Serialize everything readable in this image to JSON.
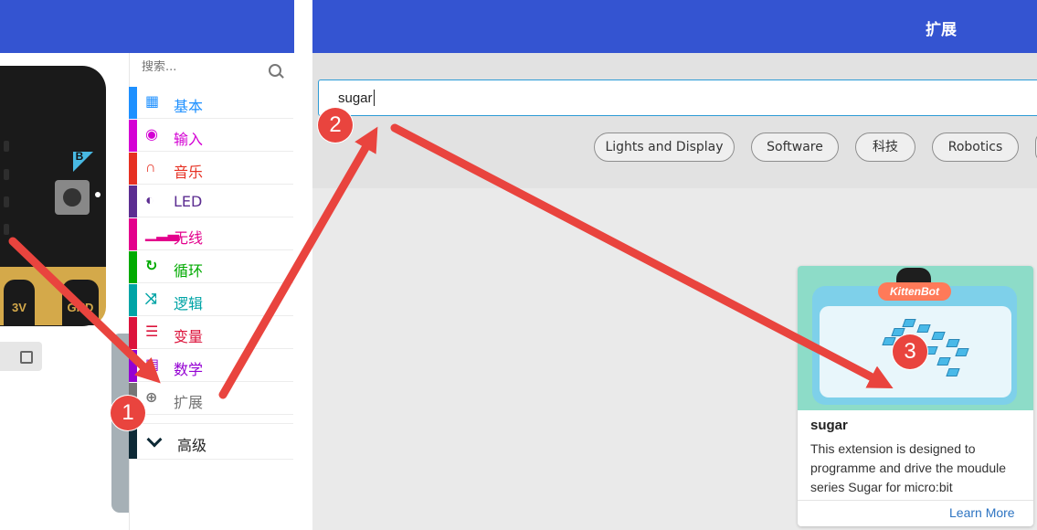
{
  "toolbox": {
    "search_placeholder": "搜索...",
    "categories": [
      {
        "label": "基本",
        "color": "#1e90ff",
        "icon": "grid-icon"
      },
      {
        "label": "输入",
        "color": "#d400d4",
        "icon": "target-icon"
      },
      {
        "label": "音乐",
        "color": "#e63022",
        "icon": "headphones-icon"
      },
      {
        "label": "LED",
        "color": "#5c2d91",
        "icon": "toggle-icon"
      },
      {
        "label": "无线",
        "color": "#e3008c",
        "icon": "signal-bars-icon"
      },
      {
        "label": "循环",
        "color": "#00aa00",
        "icon": "refresh-icon"
      },
      {
        "label": "逻辑",
        "color": "#00a4a6",
        "icon": "shuffle-icon"
      },
      {
        "label": "变量",
        "color": "#dc143c",
        "icon": "list-icon"
      },
      {
        "label": "数学",
        "color": "#9400d3",
        "icon": "calculator-icon"
      },
      {
        "label": "扩展",
        "color": "#757575",
        "icon": "plus-circle-icon"
      }
    ],
    "advanced_label": "高级"
  },
  "simulator": {
    "button_letter": "B",
    "pin_labels": [
      "3V",
      "GND"
    ]
  },
  "extensions": {
    "title": "扩展",
    "search_value": "sugar",
    "chips": [
      "Lights and Display",
      "Software",
      "科技",
      "Robotics"
    ],
    "card": {
      "logo": "KittenBot",
      "title": "sugar",
      "description": "This extension is designed to programme and drive the moudule series Sugar for micro:bit",
      "link": "Learn More"
    }
  },
  "annotations": {
    "steps": [
      "1",
      "2",
      "3"
    ],
    "color": "#e9443e"
  }
}
